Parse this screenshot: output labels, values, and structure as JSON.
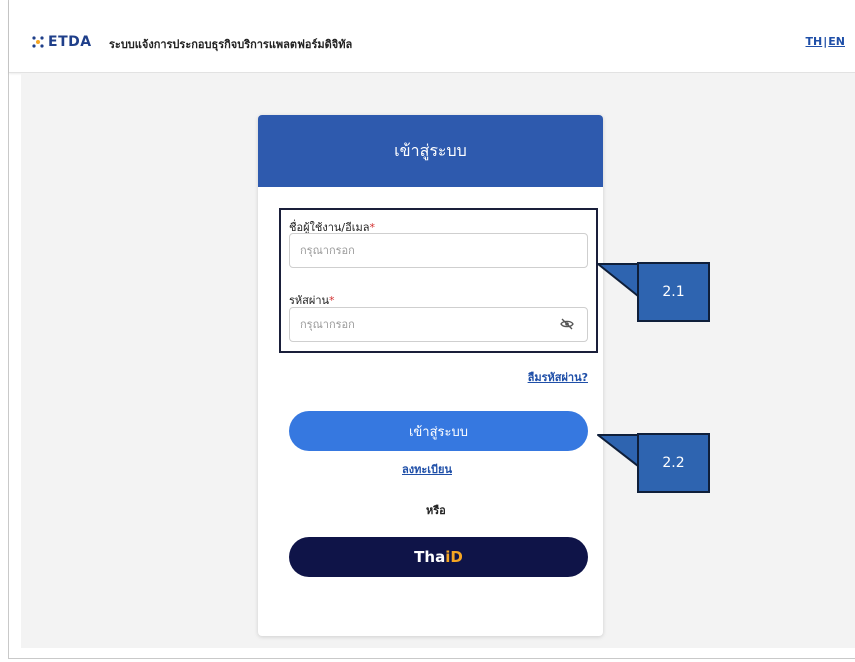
{
  "header": {
    "logo_text": "ETDA",
    "app_title": "ระบบแจ้งการประกอบธุรกิจบริการแพลตฟอร์มดิจิทัล",
    "lang_th": "TH",
    "lang_sep": "|",
    "lang_en": "EN"
  },
  "login": {
    "title": "เข้าสู่ระบบ",
    "username_label": "ชื่อผู้ใช้งาน/อีเมล",
    "username_placeholder": "กรุณากรอก",
    "username_value": "",
    "password_label": "รหัสผ่าน",
    "password_placeholder": "กรุณากรอก",
    "password_value": "",
    "required_mark": "*",
    "forgot_password": "ลืมรหัสผ่าน?",
    "login_button": "เข้าสู่ระบบ",
    "register_link": "ลงทะเบียน",
    "or_text": "หรือ",
    "thaid_part1": "Tha",
    "thaid_part2": "iD"
  },
  "annotations": {
    "callout_1": "2.1",
    "callout_2": "2.2"
  },
  "colors": {
    "header_blue": "#2e5aae",
    "login_button": "#3678e0",
    "thaid_button": "#0f1448",
    "thaid_accent": "#f5a623",
    "link": "#1f4fa8",
    "required": "#d32f2f",
    "callout": "#2e64b0"
  },
  "icons": {
    "logo": "etda-logo-icon",
    "password_toggle": "eye-off-icon"
  }
}
